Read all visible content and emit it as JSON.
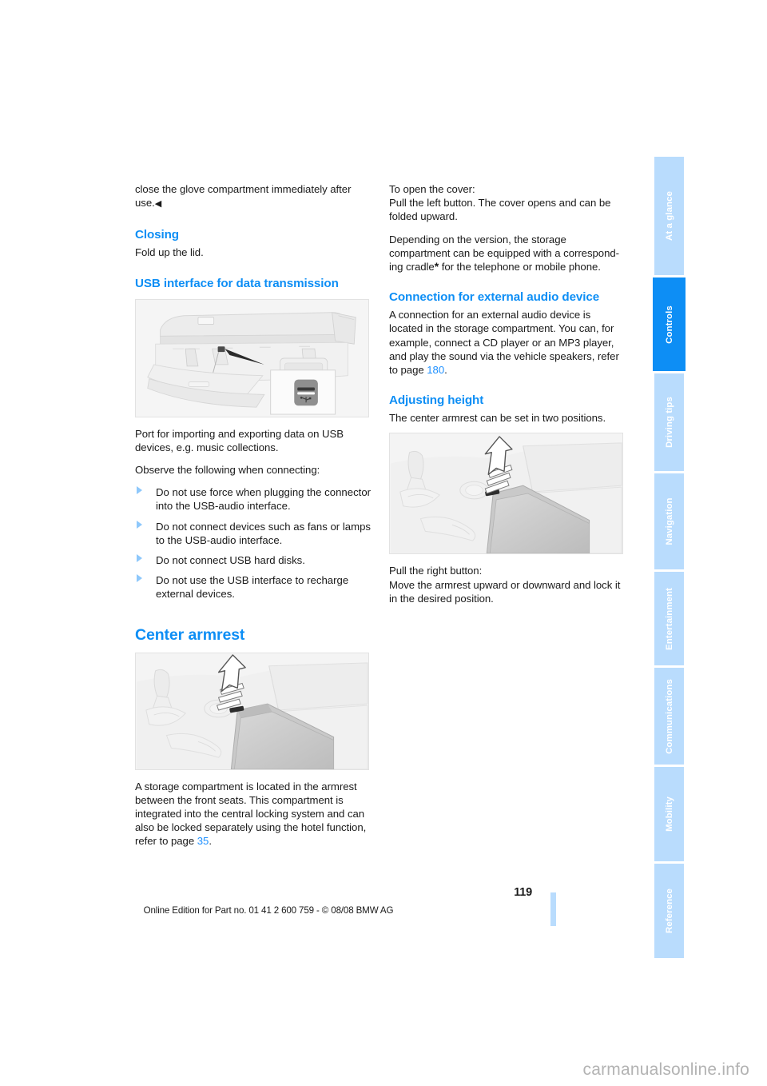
{
  "document": {
    "page_number": "119",
    "edition_line": "Online Edition for Part no. 01 41 2 600 759 - © 08/08 BMW AG",
    "watermark": "carmanualsonline.info",
    "accent_color": "#0d8ef5",
    "tab_inactive_color": "#b9dcfd",
    "link_color": "#1e90ff"
  },
  "tabs": [
    {
      "label": "At a glance",
      "active": false
    },
    {
      "label": "Controls",
      "active": true
    },
    {
      "label": "Driving tips",
      "active": false
    },
    {
      "label": "Navigation",
      "active": false
    },
    {
      "label": "Entertainment",
      "active": false
    },
    {
      "label": "Communications",
      "active": false
    },
    {
      "label": "Mobility",
      "active": false
    },
    {
      "label": "Reference",
      "active": false
    }
  ],
  "left_column": {
    "intro_text": "close the glove compartment immediately after use.",
    "intro_endmark": "◀",
    "closing": {
      "heading": "Closing",
      "text": "Fold up the lid."
    },
    "usb": {
      "heading": "USB interface for data transmission",
      "figure_caption": "glove-compartment-usb-port-illustration",
      "para_1": "Port for importing and exporting data on USB devices, e.g. music collections.",
      "para_2": "Observe the following when connecting:",
      "bullets": [
        "Do not use force when plugging the connector into the USB-audio interface.",
        "Do not connect devices such as fans or lamps to the USB-audio interface.",
        "Do not connect USB hard disks.",
        "Do not use the USB interface to recharge external devices."
      ]
    },
    "center_armrest": {
      "heading": "Center armrest",
      "figure_caption": "center-armrest-console-illustration",
      "para_1_a": "A storage compartment is located in the armrest between the front seats. This compartment is integrated into the central locking system and can also be locked separately using the hotel function, refer to page ",
      "para_1_link": "35",
      "para_1_b": "."
    }
  },
  "right_column": {
    "open_cover": {
      "line_1": "To open the cover:",
      "line_2": "Pull the left button. The cover opens and can be folded upward."
    },
    "cradle": {
      "text_a": "Depending on the version, the storage compartment can be equipped with a correspond-ing cradle",
      "star": "*",
      "text_b": " for the telephone or mobile phone."
    },
    "external_audio": {
      "heading": "Connection for external audio device",
      "text_a": "A connection for an external audio device is located in the storage compartment. You can, for example, connect a CD player or an MP3 player, and play the sound via the vehicle speakers, refer to page ",
      "link": "180",
      "text_b": "."
    },
    "adjusting_height": {
      "heading": "Adjusting height",
      "intro": "The center armrest can be set in two positions.",
      "figure_caption": "armrest-height-adjust-illustration",
      "line_1": "Pull the right button:",
      "line_2": "Move the armrest upward or downward and lock it in the desired position."
    }
  }
}
